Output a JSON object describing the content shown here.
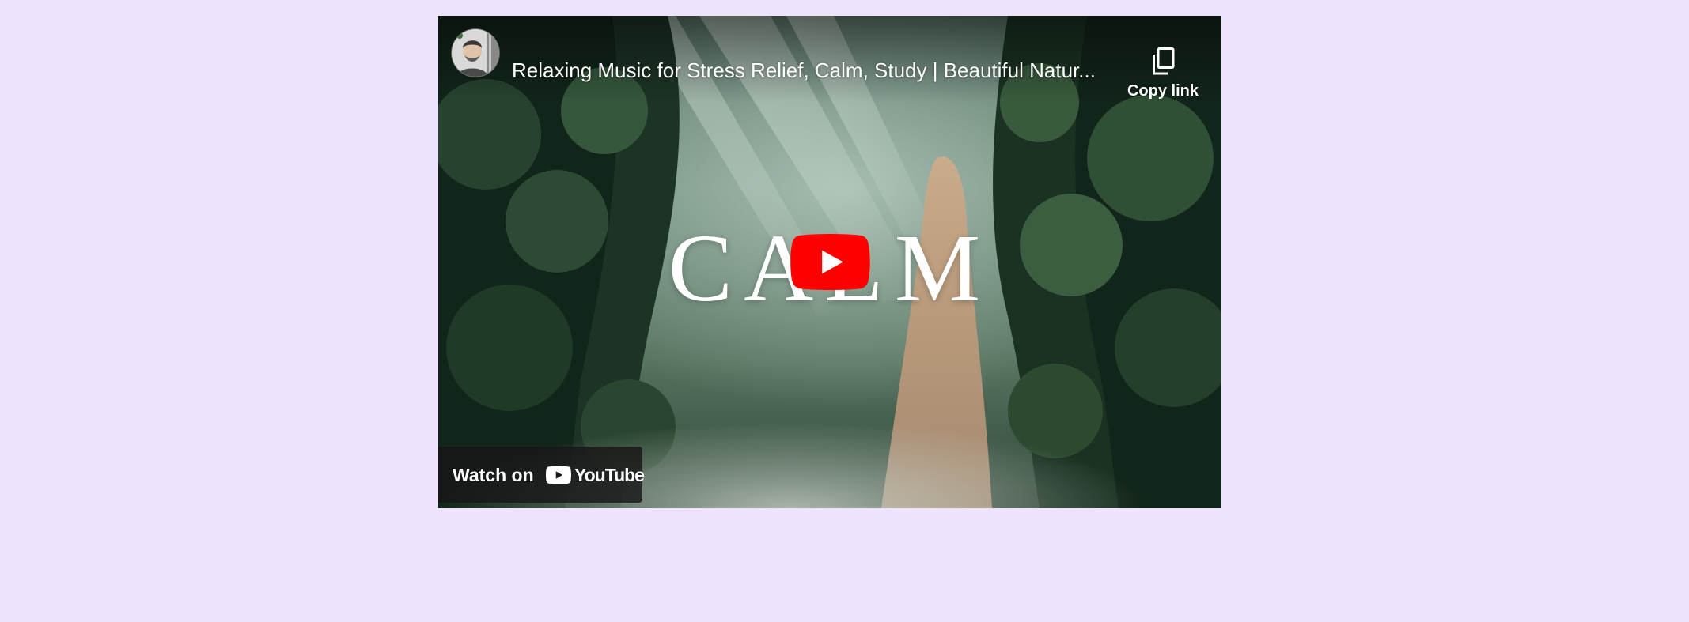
{
  "video": {
    "title": "Relaxing Music for Stress Relief, Calm, Study | Beautiful Natur...",
    "overlay_word": "CALM",
    "thumbnail_icon": "jungle-waterfall-thumbnail"
  },
  "channel": {
    "avatar_icon": "channel-avatar-icon"
  },
  "copy_link": {
    "label": "Copy link",
    "icon": "copy-icon"
  },
  "play_button": {
    "icon": "play-icon",
    "color": "#FF0000"
  },
  "watch_on": {
    "label": "Watch on",
    "logo_text": "YouTube",
    "logo_icon": "youtube-logo-icon"
  },
  "colors": {
    "page_background": "#EDE3FD",
    "youtube_red": "#FF0000",
    "watch_on_background": "#171717"
  }
}
